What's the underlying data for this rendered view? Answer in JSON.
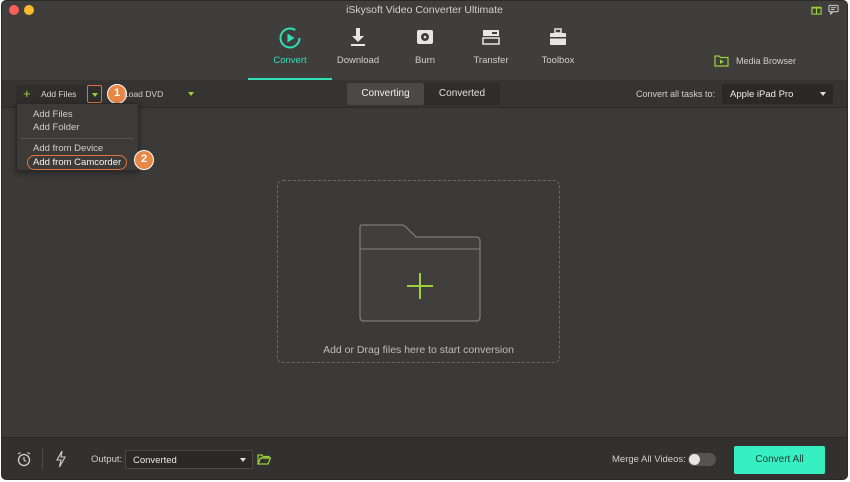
{
  "window": {
    "title": "iSkysoft Video Converter Ultimate"
  },
  "nav": {
    "items": [
      {
        "label": "Convert",
        "icon": "convert-icon",
        "active": true
      },
      {
        "label": "Download",
        "icon": "download-icon",
        "active": false
      },
      {
        "label": "Burn",
        "icon": "burn-disc-icon",
        "active": false
      },
      {
        "label": "Transfer",
        "icon": "transfer-icon",
        "active": false
      },
      {
        "label": "Toolbox",
        "icon": "toolbox-icon",
        "active": false
      }
    ],
    "media_browser": "Media Browser"
  },
  "subbar": {
    "add_files": "Add Files",
    "load_dvd": "Load DVD",
    "tabs": {
      "converting": "Converting",
      "converted": "Converted",
      "selected": "Converting"
    },
    "convert_all_tasks_label": "Convert all tasks to:",
    "target_device": "Apple iPad Pro"
  },
  "callouts": {
    "first": "1",
    "second": "2"
  },
  "add_menu": {
    "items": [
      "Add Files",
      "Add Folder",
      "Add from Device",
      "Add from Camcorder"
    ],
    "highlighted": "Add from Camcorder"
  },
  "dropzone": {
    "text": "Add or Drag files here to start conversion"
  },
  "bottom": {
    "output_label": "Output:",
    "output_value": "Converted",
    "merge_label": "Merge All Videos:",
    "merge_on": false,
    "convert_all": "Convert All"
  },
  "colors": {
    "accent": "#2de0b6",
    "button": "#36f0c2",
    "highlight": "#e0713a",
    "plus": "#9bd13b"
  }
}
